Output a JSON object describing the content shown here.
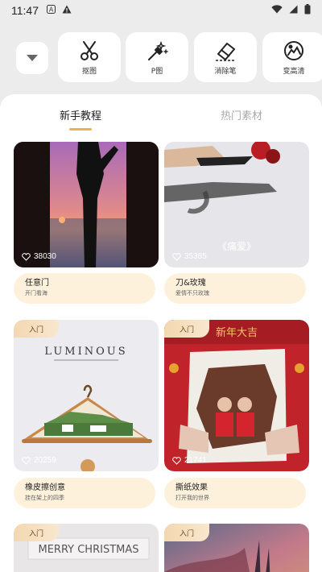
{
  "status_bar": {
    "time": "11:47"
  },
  "tools": [
    {
      "label": "抠图",
      "icon": "scissors-icon"
    },
    {
      "label": "P图",
      "icon": "magic-wand-icon"
    },
    {
      "label": "消除笔",
      "icon": "eraser-icon"
    },
    {
      "label": "变高清",
      "icon": "enhance-icon"
    }
  ],
  "tabs": [
    {
      "label": "新手教程",
      "active": true
    },
    {
      "label": "热门素材",
      "active": false
    }
  ],
  "cards": [
    {
      "title": "任意门",
      "subtitle": "开门看海",
      "likes": "38030",
      "badge": ""
    },
    {
      "title": "刀&玫瑰",
      "subtitle": "爱情不只玫瑰",
      "likes": "35385",
      "badge": "",
      "overlay_text": "《痛爱》"
    },
    {
      "title": "橡皮擦创意",
      "subtitle": "挂在架上的四季",
      "likes": "20259",
      "badge": "入门",
      "overlay_text": "LUMINOUS"
    },
    {
      "title": "撕纸效果",
      "subtitle": "打开我的世界",
      "likes": "21741",
      "badge": "入门",
      "overlay_text": "新年大吉"
    },
    {
      "title": "",
      "subtitle": "",
      "likes": "",
      "badge": "入门",
      "overlay_text": "MERRY  CHRISTMAS"
    },
    {
      "title": "",
      "subtitle": "",
      "likes": "",
      "badge": "入门"
    }
  ],
  "colors": {
    "accent": "#f0b050",
    "caption_bg": "#fdf1dc",
    "badge_text": "#6b4a22"
  }
}
